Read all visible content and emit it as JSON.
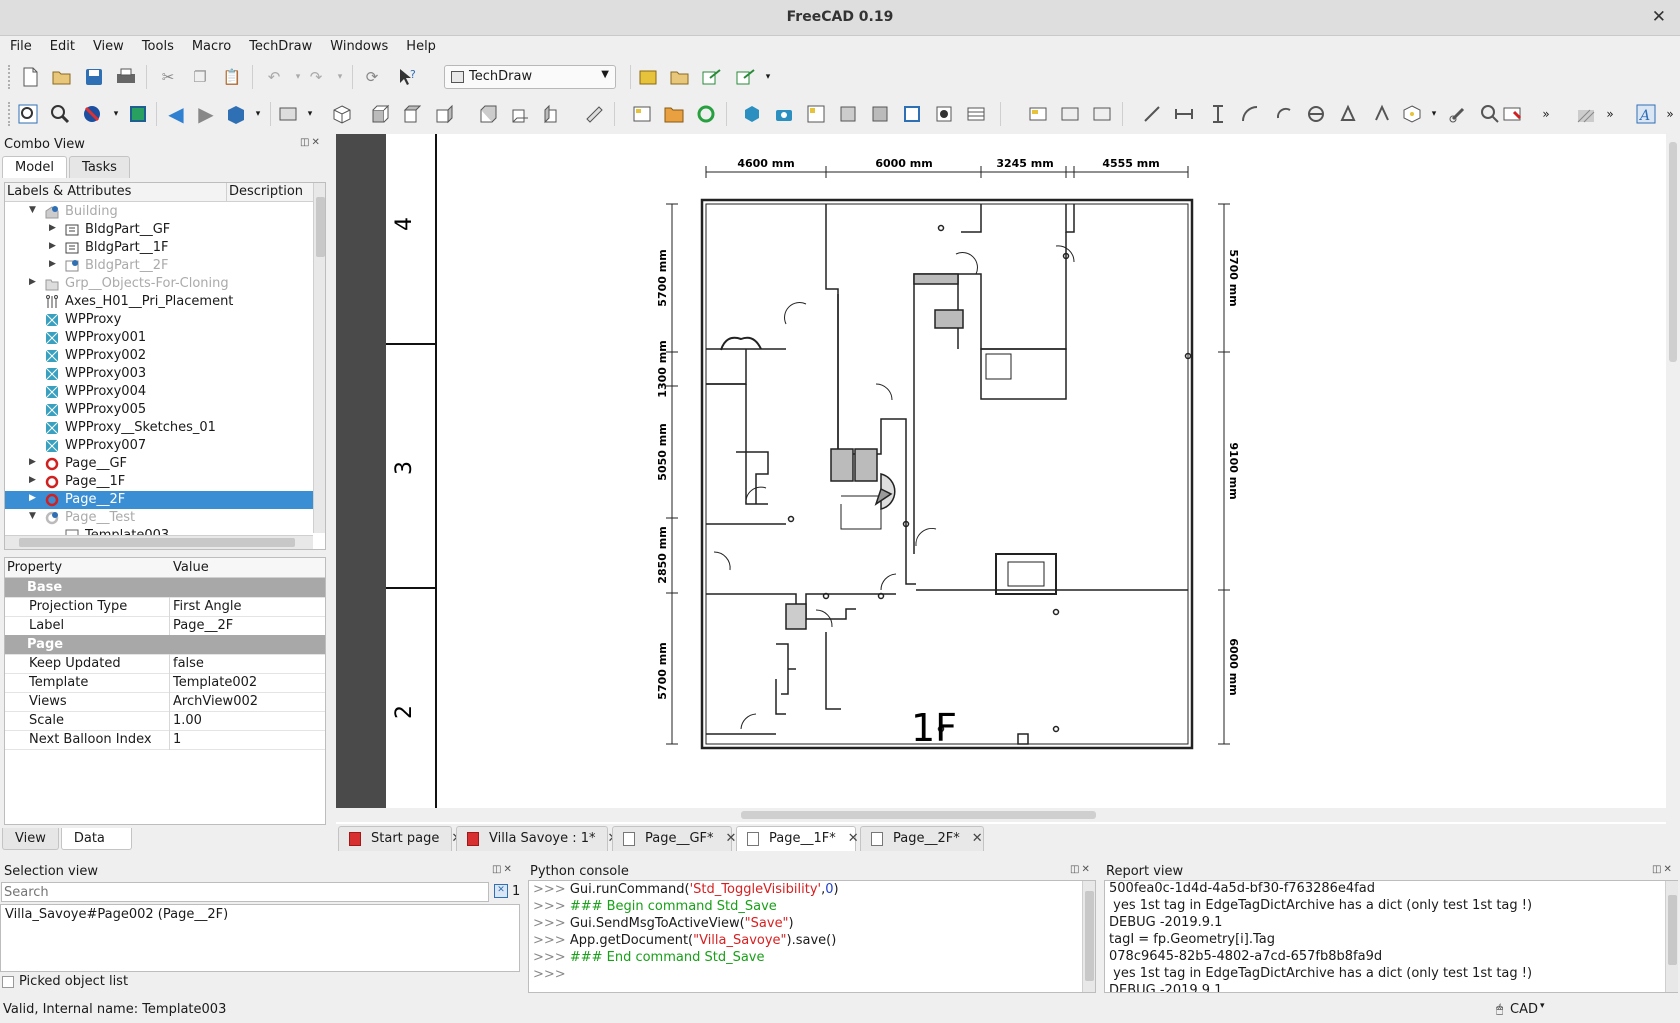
{
  "window": {
    "title": "FreeCAD 0.19"
  },
  "menu": [
    "File",
    "Edit",
    "View",
    "Tools",
    "Macro",
    "TechDraw",
    "Windows",
    "Help"
  ],
  "workbench": "TechDraw",
  "combo": {
    "title": "Combo View",
    "tabs": [
      "Model",
      "Tasks"
    ],
    "tree_headers": [
      "Labels & Attributes",
      "Description"
    ],
    "tree": [
      {
        "label": "Building",
        "indent": 1,
        "arrow": "down",
        "icon": "building",
        "dim": true
      },
      {
        "label": "BldgPart__GF",
        "indent": 2,
        "arrow": "right",
        "icon": "bldgpart"
      },
      {
        "label": "BldgPart__1F",
        "indent": 2,
        "arrow": "right",
        "icon": "bldgpart"
      },
      {
        "label": "BldgPart__2F",
        "indent": 2,
        "arrow": "right",
        "icon": "bldgpart-check",
        "dim": true
      },
      {
        "label": "Grp__Objects-For-Cloning",
        "indent": 1,
        "arrow": "right",
        "icon": "folder",
        "dim": true
      },
      {
        "label": "Axes_H01__Pri_Placement",
        "indent": 1,
        "arrow": "",
        "icon": "axes"
      },
      {
        "label": "WPProxy",
        "indent": 1,
        "arrow": "",
        "icon": "wpproxy"
      },
      {
        "label": "WPProxy001",
        "indent": 1,
        "arrow": "",
        "icon": "wpproxy"
      },
      {
        "label": "WPProxy002",
        "indent": 1,
        "arrow": "",
        "icon": "wpproxy"
      },
      {
        "label": "WPProxy003",
        "indent": 1,
        "arrow": "",
        "icon": "wpproxy"
      },
      {
        "label": "WPProxy004",
        "indent": 1,
        "arrow": "",
        "icon": "wpproxy"
      },
      {
        "label": "WPProxy005",
        "indent": 1,
        "arrow": "",
        "icon": "wpproxy"
      },
      {
        "label": "WPProxy__Sketches_01",
        "indent": 1,
        "arrow": "",
        "icon": "wpproxy"
      },
      {
        "label": "WPProxy007",
        "indent": 1,
        "arrow": "",
        "icon": "wpproxy"
      },
      {
        "label": "Page__GF",
        "indent": 1,
        "arrow": "right",
        "icon": "page-refresh"
      },
      {
        "label": "Page__1F",
        "indent": 1,
        "arrow": "right",
        "icon": "page-refresh"
      },
      {
        "label": "Page__2F",
        "indent": 1,
        "arrow": "right",
        "icon": "page-refresh",
        "selected": true
      },
      {
        "label": "Page__Test",
        "indent": 1,
        "arrow": "down",
        "icon": "page-check",
        "dim": true
      },
      {
        "label": "Template003",
        "indent": 2,
        "arrow": "",
        "icon": "template"
      }
    ],
    "prop_headers": [
      "Property",
      "Value"
    ],
    "props": [
      {
        "group": "Base"
      },
      {
        "k": "Projection Type",
        "v": "First Angle"
      },
      {
        "k": "Label",
        "v": "Page__2F"
      },
      {
        "group": "Page"
      },
      {
        "k": "Keep Updated",
        "v": "false"
      },
      {
        "k": "Template",
        "v": "Template002"
      },
      {
        "k": "Views",
        "v": "ArchView002"
      },
      {
        "k": "Scale",
        "v": "1.00"
      },
      {
        "k": "Next Balloon Index",
        "v": "1"
      }
    ],
    "bottom_tabs": [
      "View",
      "Data"
    ]
  },
  "drawing": {
    "top_dims": [
      "4600 mm",
      "6000 mm",
      "3245 mm",
      "4555 mm"
    ],
    "left_dims": [
      "5700 mm",
      "1300 mm",
      "5050 mm",
      "2850 mm",
      "5700 mm"
    ],
    "right_dims": [
      "5700 mm",
      "9100 mm",
      "6000 mm"
    ],
    "grid_numbers": [
      "4",
      "3",
      "2"
    ],
    "floor_label": "1F"
  },
  "doc_tabs": [
    {
      "label": "Start page",
      "icon": "freecad"
    },
    {
      "label": "Villa Savoye : 1*",
      "icon": "freecad"
    },
    {
      "label": "Page__GF*",
      "icon": "page"
    },
    {
      "label": "Page__1F*",
      "icon": "page",
      "active": true
    },
    {
      "label": "Page__2F*",
      "icon": "page"
    }
  ],
  "selection_view": {
    "title": "Selection view",
    "search_placeholder": "Search",
    "count": "1",
    "items": [
      "Villa_Savoye#Page002 (Page__2F)"
    ],
    "picked_label": "Picked object list"
  },
  "python_console": {
    "title": "Python console",
    "lines": [
      [
        {
          "t": ">>> ",
          "c": "prompt"
        },
        {
          "t": "Gui.runCommand(",
          "c": ""
        },
        {
          "t": "'Std_ToggleVisibility'",
          "c": "str"
        },
        {
          "t": ",",
          "c": ""
        },
        {
          "t": "0",
          "c": "num"
        },
        {
          "t": ")",
          "c": ""
        }
      ],
      [
        {
          "t": ">>> ",
          "c": "prompt"
        },
        {
          "t": "### Begin command Std_Save",
          "c": "cmt"
        }
      ],
      [
        {
          "t": ">>> ",
          "c": "prompt"
        },
        {
          "t": "Gui.SendMsgToActiveView(",
          "c": ""
        },
        {
          "t": "\"Save\"",
          "c": "str"
        },
        {
          "t": ")",
          "c": ""
        }
      ],
      [
        {
          "t": ">>> ",
          "c": "prompt"
        },
        {
          "t": "App.getDocument(",
          "c": ""
        },
        {
          "t": "\"Villa_Savoye\"",
          "c": "str"
        },
        {
          "t": ").save()",
          "c": ""
        }
      ],
      [
        {
          "t": ">>> ",
          "c": "prompt"
        },
        {
          "t": "### End command Std_Save",
          "c": "cmt"
        }
      ],
      [
        {
          "t": ">>> ",
          "c": "prompt"
        }
      ]
    ]
  },
  "report_view": {
    "title": "Report view",
    "lines": [
      "500fea0c-1d4d-4a5d-bf30-f763286e4fad",
      " yes 1st tag in EdgeTagDictArchive has a dict (only test 1st tag !)",
      "DEBUG -2019.9.1",
      "tagI = fp.Geometry[i].Tag",
      "078c9645-82b5-4802-a7cd-657fb8b8fa9d",
      " yes 1st tag in EdgeTagDictArchive has a dict (only test 1st tag !)",
      "DEBUG -2019.9.1"
    ]
  },
  "status": {
    "text": "Valid, Internal name: Template003",
    "nav": "CAD"
  },
  "colors": {
    "selection": "#3a8fd4",
    "group_row": "#a8a8a8",
    "ruler": "#4a4a4a"
  }
}
